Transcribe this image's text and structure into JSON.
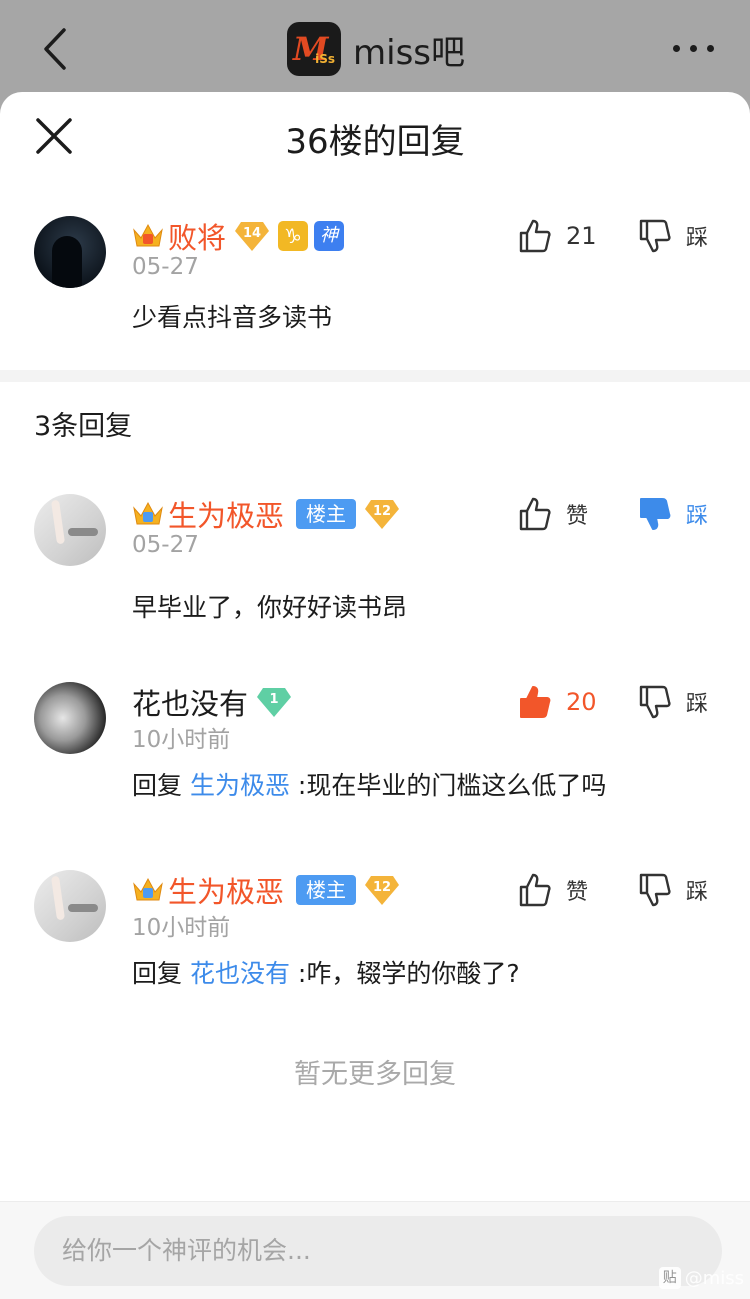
{
  "topbar": {
    "forum_name": "miss吧",
    "logo_text": "M",
    "logo_sub": "iSs"
  },
  "sheet": {
    "title": "36楼的回复"
  },
  "main_comment": {
    "username": "败将",
    "level": "14",
    "zodiac_icon": "capricorn-icon",
    "zodiac_glyph": "♑",
    "god_badge": "神",
    "time": "05-27",
    "text": "少看点抖音多读书",
    "like_count": "21",
    "dislike_label": "踩"
  },
  "reply_count_label": "3条回复",
  "replies": [
    {
      "username": "生为极恶",
      "host_tag": "楼主",
      "level": "12",
      "time": "05-27",
      "text": "早毕业了，你好好读书昂",
      "like_label": "赞",
      "dislike_label": "踩",
      "dislike_active": true
    },
    {
      "username": "花也没有",
      "level": "1",
      "time": "10小时前",
      "reply_prefix": "回复 ",
      "mention": "生为极恶",
      "text": " :现在毕业的门槛这么低了吗",
      "like_count": "20",
      "like_active": true,
      "dislike_label": "踩"
    },
    {
      "username": "生为极恶",
      "host_tag": "楼主",
      "level": "12",
      "time": "10小时前",
      "reply_prefix": "回复 ",
      "mention": "花也没有",
      "text": " :咋，辍学的你酸了?",
      "like_label": "赞",
      "dislike_label": "踩"
    }
  ],
  "no_more_label": "暂无更多回复",
  "input": {
    "placeholder": "给你一个神评的机会..."
  },
  "watermark": {
    "box": "贴",
    "text": "@miss"
  },
  "colors": {
    "accent_blue": "#3d8bea",
    "vip_name": "#f2562a",
    "host_tag": "#4d9bf2",
    "muted": "#a3a3a3"
  }
}
